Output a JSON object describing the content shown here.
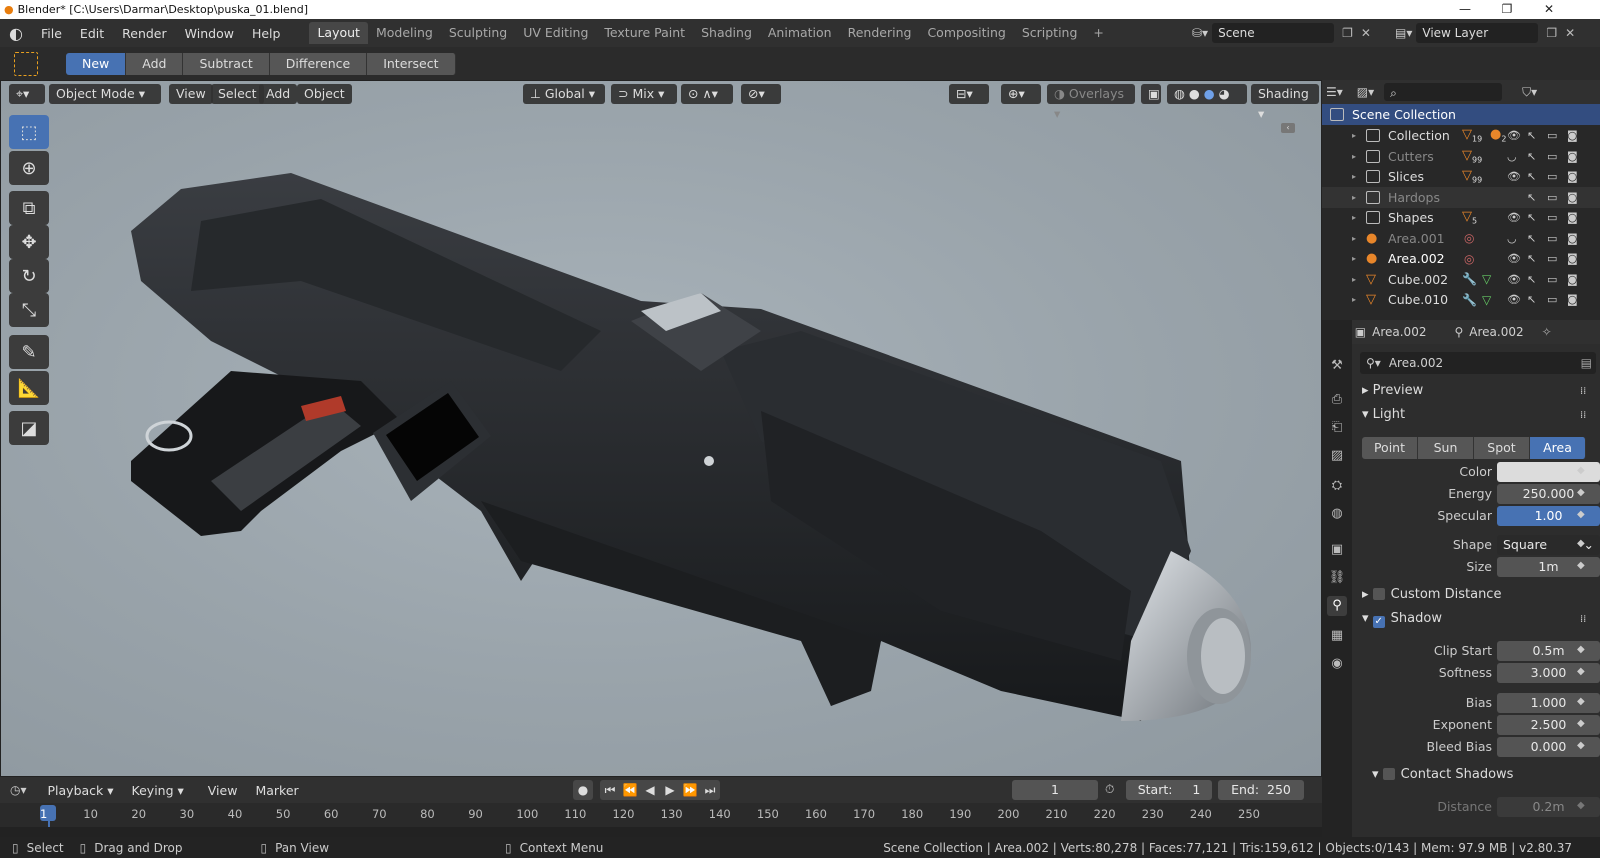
{
  "window": {
    "title": "Blender* [C:\\Users\\Darmar\\Desktop\\puska_01.blend]",
    "min": "—",
    "max": "❐",
    "close": "✕"
  },
  "menus": [
    "File",
    "Edit",
    "Render",
    "Window",
    "Help"
  ],
  "workspaces": [
    "Layout",
    "Modeling",
    "Sculpting",
    "UV Editing",
    "Texture Paint",
    "Shading",
    "Animation",
    "Rendering",
    "Compositing",
    "Scripting"
  ],
  "add_workspace": "+",
  "scene": {
    "name": "Scene",
    "view_layer": "View Layer"
  },
  "tool_header": {
    "buttons": [
      "New",
      "Add",
      "Subtract",
      "Difference",
      "Intersect"
    ]
  },
  "viewport": {
    "mode": "Object Mode",
    "menus": [
      "View",
      "Select",
      "Add",
      "Object"
    ],
    "orientation": "Global",
    "snap": "Mix",
    "overlays": "Overlays",
    "shading": "Shading"
  },
  "outliner": {
    "root": "Scene Collection",
    "items": [
      {
        "name": "Collection",
        "badge1": "19",
        "badge2": "2",
        "dim": false
      },
      {
        "name": "Cutters",
        "badge1": "99",
        "badge2": "",
        "dim": true
      },
      {
        "name": "Slices",
        "badge1": "99",
        "badge2": "",
        "dim": false
      },
      {
        "name": "Hardops",
        "badge1": "",
        "badge2": "",
        "dim": true
      },
      {
        "name": "Shapes",
        "badge1": "5",
        "badge2": "",
        "dim": false
      },
      {
        "name": "Area.001",
        "badge1": "",
        "badge2": "",
        "dim": true
      },
      {
        "name": "Area.002",
        "badge1": "",
        "badge2": "",
        "dim": false
      },
      {
        "name": "Cube.002",
        "badge1": "",
        "badge2": "",
        "dim": false
      },
      {
        "name": "Cube.010",
        "badge1": "",
        "badge2": "",
        "dim": false
      }
    ]
  },
  "properties": {
    "object": "Area.002",
    "data": "Area.002",
    "datablock": "Area.002",
    "panels": {
      "preview": "Preview",
      "light": "Light",
      "custom_distance": "Custom Distance",
      "shadow": "Shadow",
      "contact_shadows": "Contact Shadows"
    },
    "light_types": [
      "Point",
      "Sun",
      "Spot",
      "Area"
    ],
    "color_label": "Color",
    "color_value": "#dcdcdc",
    "energy_label": "Energy",
    "energy": "250.000",
    "specular_label": "Specular",
    "specular": "1.00",
    "shape_label": "Shape",
    "shape": "Square",
    "size_label": "Size",
    "size": "1m",
    "clip_start_label": "Clip Start",
    "clip_start": "0.5m",
    "softness_label": "Softness",
    "softness": "3.000",
    "bias_label": "Bias",
    "bias": "1.000",
    "exponent_label": "Exponent",
    "exponent": "2.500",
    "bleed_bias_label": "Bleed Bias",
    "bleed_bias": "0.000",
    "distance_label": "Distance",
    "distance": "0.2m"
  },
  "timeline": {
    "menus": [
      "Playback",
      "Keying",
      "View",
      "Marker"
    ],
    "current_frame": "1",
    "start_label": "Start:",
    "start": "1",
    "end_label": "End:",
    "end": "250",
    "ticks": [
      "1",
      "10",
      "20",
      "30",
      "40",
      "50",
      "60",
      "70",
      "80",
      "90",
      "100",
      "110",
      "120",
      "130",
      "140",
      "150",
      "160",
      "170",
      "180",
      "190",
      "200",
      "210",
      "220",
      "230",
      "240",
      "250"
    ]
  },
  "statusbar": {
    "select": "Select",
    "drag": "Drag and Drop",
    "pan": "Pan View",
    "context": "Context Menu",
    "stats": "Scene Collection | Area.002 | Verts:80,278 | Faces:77,121 | Tris:159,612 | Objects:0/143 | Mem: 97.9 MB | v2.80.37"
  },
  "colors": {
    "accent": "#4772b3",
    "orange": "#e8862a"
  }
}
